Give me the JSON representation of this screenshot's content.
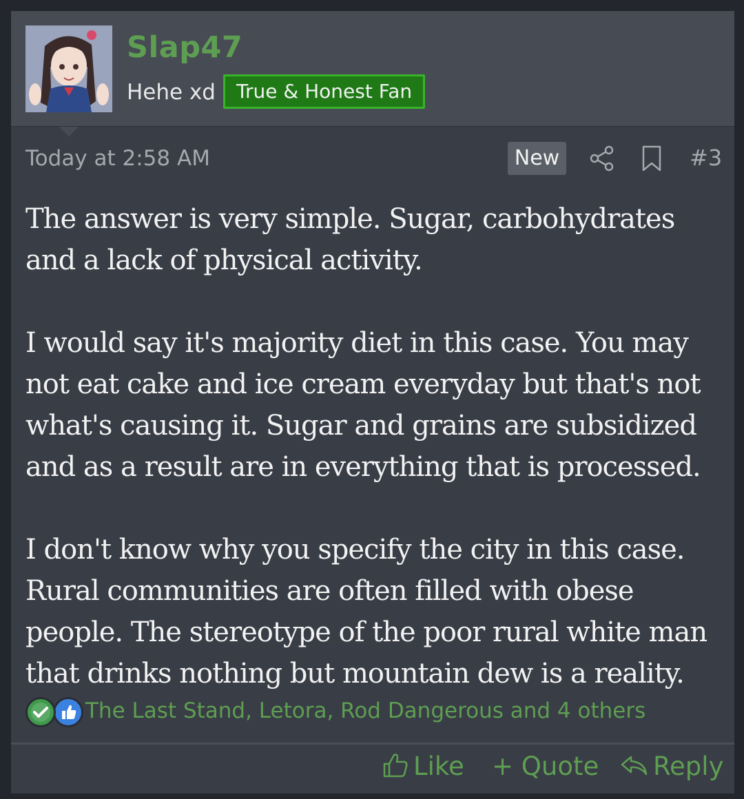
{
  "user": {
    "name": "Slap47",
    "title": "Hehe xd",
    "banner": "True & Honest Fan"
  },
  "meta": {
    "time": "Today at 2:58 AM",
    "new_badge": "New",
    "post_number": "#3",
    "icons": [
      "share-icon",
      "bookmark-icon"
    ]
  },
  "body": {
    "paragraphs": [
      [
        "The answer is very simple. Sugar, carbohydrates",
        "and a lack of physical activity."
      ],
      [
        "I would say it's majority diet in this case. You may",
        "not eat cake and ice cream everyday but that's not",
        "what's causing it. Sugar and grains are subsidized",
        "and as a result are in everything that is processed."
      ],
      [
        "I don't know why you specify the city in this case.",
        "Rural communities are often filled with obese",
        "people. The stereotype of the poor rural white man",
        "that drinks nothing but mountain dew is a reality."
      ]
    ]
  },
  "reactions": {
    "icons": [
      "agree-icon",
      "like-icon"
    ],
    "users": "The Last Stand, Letora, Rod Dangerous and 4 others"
  },
  "actions": {
    "like": "Like",
    "quote": "+ Quote",
    "reply": "Reply"
  },
  "colors": {
    "accent": "#5e9e52",
    "banner_bg": "#1f7a16",
    "background": "#393d46"
  }
}
